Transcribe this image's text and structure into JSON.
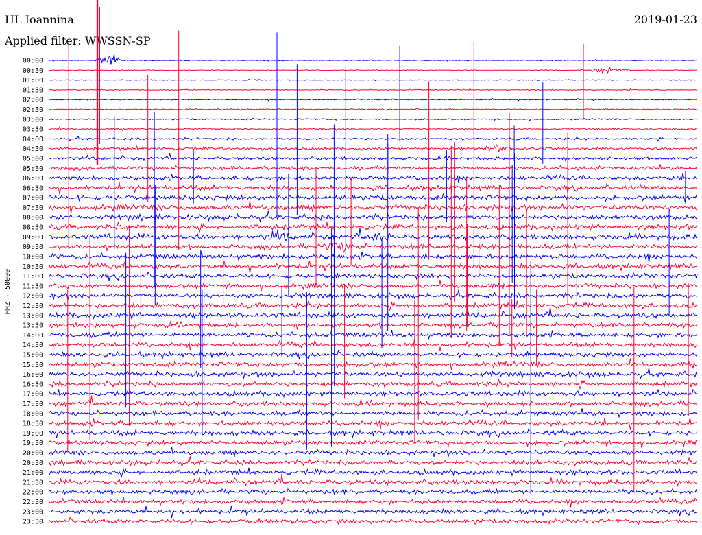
{
  "header": {
    "station": "HL Ioannina",
    "filter_label": "Applied filter: WWSSN-SP",
    "date": "2019-01-23"
  },
  "chart_data": {
    "type": "line",
    "title": "HL Ioannina",
    "ylabel": "HHZ - 50000",
    "date": "2019-01-23",
    "filter": "WWSSN-SP",
    "row_labels": [
      "00:00",
      "00:30",
      "01:00",
      "01:30",
      "02:00",
      "02:30",
      "03:00",
      "03:30",
      "04:00",
      "04:30",
      "05:00",
      "05:30",
      "06:00",
      "06:30",
      "07:00",
      "07:30",
      "08:00",
      "08:30",
      "09:00",
      "09:30",
      "10:00",
      "10:30",
      "11:00",
      "11:30",
      "12:00",
      "12:30",
      "13:00",
      "13:30",
      "14:00",
      "14:30",
      "15:00",
      "15:30",
      "16:00",
      "16:30",
      "17:00",
      "17:30",
      "18:00",
      "18:30",
      "19:00",
      "19:30",
      "20:00",
      "20:30",
      "21:00",
      "21:30",
      "22:00",
      "22:30",
      "23:00",
      "23:30"
    ],
    "series_colors": [
      "#0000ff",
      "#ff0033"
    ],
    "noise_amplitude": [
      0.4,
      0.4,
      0.4,
      0.5,
      0.5,
      0.6,
      0.7,
      0.8,
      1.0,
      1.3,
      1.6,
      1.9,
      2.2,
      2.4,
      2.5,
      2.6,
      2.6,
      2.6,
      2.6,
      2.5,
      2.5,
      2.4,
      2.4,
      2.4,
      2.4,
      2.4,
      2.4,
      2.4,
      2.4,
      2.4,
      2.4,
      2.4,
      2.4,
      2.4,
      2.4,
      2.4,
      2.4,
      2.4,
      2.4,
      2.4,
      2.4,
      2.4,
      2.4,
      2.4,
      2.3,
      2.3,
      2.3,
      2.3
    ],
    "events": [
      {
        "row": 0,
        "x_fraction": 0.09,
        "amplitude": 9,
        "duration_fraction": 0.02
      },
      {
        "row": 1,
        "x_fraction": 0.86,
        "amplitude": 4,
        "duration_fraction": 0.03
      },
      {
        "row": 19,
        "x_fraction": 0.45,
        "amplitude": 4,
        "duration_fraction": 0.04
      },
      {
        "row": 18,
        "x_fraction": 0.35,
        "amplitude": 3.5,
        "duration_fraction": 0.03
      },
      {
        "row": 18,
        "x_fraction": 0.51,
        "amplitude": 3.5,
        "duration_fraction": 0.03
      },
      {
        "row": 9,
        "x_fraction": 0.69,
        "amplitude": 3,
        "duration_fraction": 0.03
      }
    ]
  }
}
